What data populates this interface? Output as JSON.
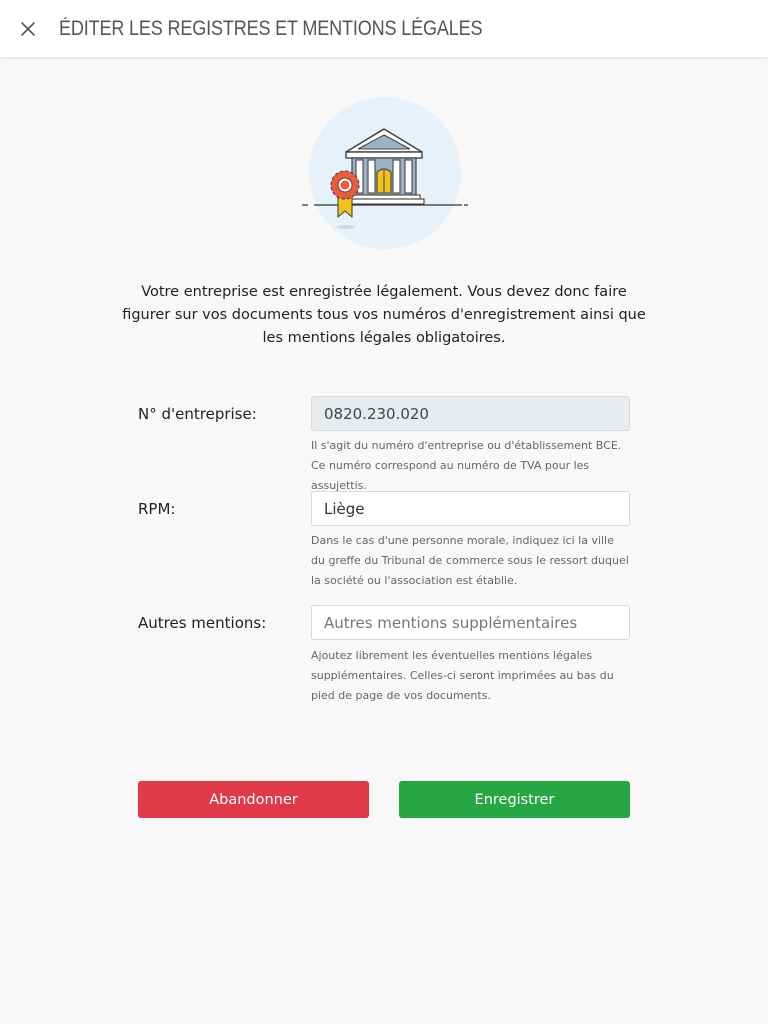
{
  "header": {
    "title": "ÉDITER LES REGISTRES ET MENTIONS LÉGALES",
    "close_icon": "close-icon"
  },
  "illustration": {
    "icon": "bank-building-with-award-ribbon"
  },
  "intro_text": "Votre entreprise est enregistrée légalement. Vous devez donc faire figurer sur vos documents tous vos numéros d'enregistrement ainsi que les mentions légales obligatoires.",
  "form": {
    "company_number": {
      "label": "N° d'entreprise:",
      "value": "0820.230.020",
      "help": "Il s'agit du numéro d'entreprise ou d'établissement BCE. Ce numéro correspond au numéro de TVA pour les assujettis."
    },
    "rpm": {
      "label": "RPM:",
      "value": "Liège",
      "help": "Dans le cas d'une personne morale, indiquez ici la ville du greffe du Tribunal de commerce sous le ressort duquel la société ou l'association est établie."
    },
    "other_mentions": {
      "label": "Autres mentions:",
      "value": "",
      "placeholder": "Autres mentions supplémentaires",
      "help": "Ajoutez librement les éventuelles mentions légales supplémentaires. Celles-ci seront imprimées au bas du pied de page de vos documents."
    }
  },
  "actions": {
    "cancel_label": "Abandonner",
    "save_label": "Enregistrer"
  },
  "colors": {
    "cancel": "#e03a48",
    "save": "#27a744",
    "illustration_circle": "#e6f1f9"
  }
}
